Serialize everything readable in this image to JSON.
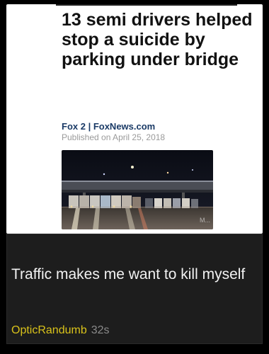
{
  "article": {
    "headline": "13 semi drivers helped stop a suicide by parking under bridge",
    "source": "Fox 2 | FoxNews.com",
    "published": "Published on April 25, 2018",
    "photo_watermark": "M..."
  },
  "comment": {
    "text": "Traffic makes me want to kill myself",
    "username": "OpticRandumb",
    "age": "32s"
  },
  "colors": {
    "username": "#d9c21a",
    "source_link": "#1a3a66",
    "comment_bg": "#1d1d1d"
  }
}
